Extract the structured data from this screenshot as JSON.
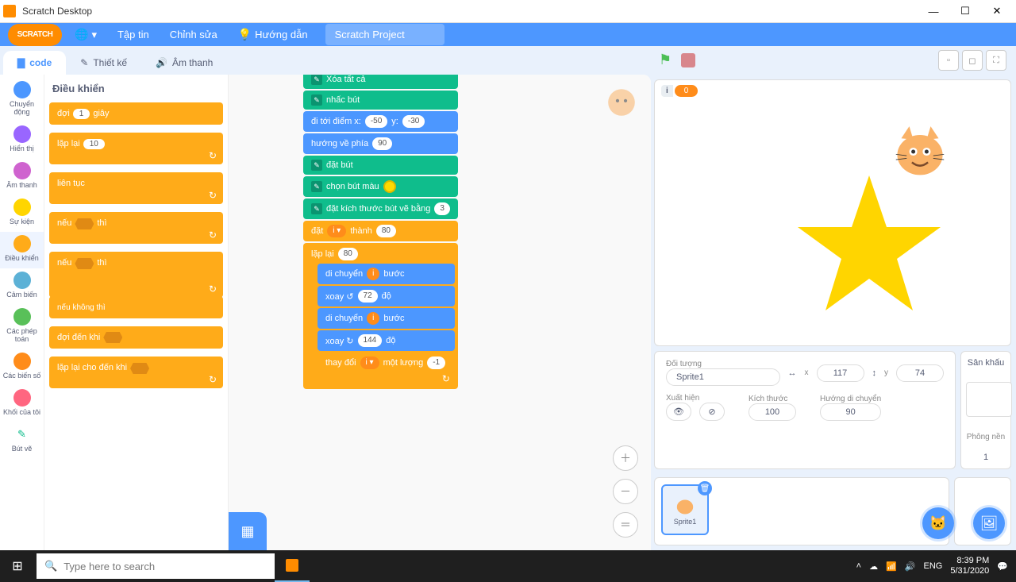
{
  "window": {
    "title": "Scratch Desktop"
  },
  "menu": {
    "file": "Tập tin",
    "edit": "Chỉnh sửa",
    "tutorials": "Hướng dẫn",
    "project_name": "Scratch Project"
  },
  "tabs": {
    "code": "code",
    "costumes": "Thiết kế",
    "sounds": "Âm thanh"
  },
  "categories": [
    {
      "name": "Chuyển động",
      "color": "#4c97ff"
    },
    {
      "name": "Hiển thị",
      "color": "#9966ff"
    },
    {
      "name": "Âm thanh",
      "color": "#cf63cf"
    },
    {
      "name": "Sự kiện",
      "color": "#ffd500"
    },
    {
      "name": "Điều khiển",
      "color": "#ffab19",
      "selected": true
    },
    {
      "name": "Cảm biến",
      "color": "#5cb1d6"
    },
    {
      "name": "Các phép toán",
      "color": "#59c059"
    },
    {
      "name": "Các biến số",
      "color": "#ff8c1a"
    },
    {
      "name": "Khối của tôi",
      "color": "#ff6680"
    },
    {
      "name": "Bút vẽ",
      "color": "#0fbd8c",
      "icon": "pen"
    }
  ],
  "palette": {
    "title": "Điều khiển",
    "blocks": {
      "wait": {
        "label": "đợi",
        "val": "1",
        "suffix": "giây"
      },
      "repeat": {
        "label": "lặp lại",
        "val": "10"
      },
      "forever": "liên tục",
      "if": {
        "pre": "nếu",
        "post": "thì"
      },
      "ifelse": {
        "pre": "nếu",
        "post": "thì"
      },
      "else_label": "nếu không thì",
      "wait_until": "đợi đến khi",
      "repeat_until": "lặp lại cho đến khi"
    }
  },
  "script": {
    "erase_all": "Xóa tất cả",
    "pen_up": "nhấc bút",
    "goto": {
      "label": "đi tới điểm x:",
      "x": "-50",
      "ymid": "y:",
      "y": "-30"
    },
    "point_dir": {
      "label": "hướng về phía",
      "val": "90"
    },
    "pen_down": "đặt bút",
    "set_color": "chọn bút màu",
    "set_size": {
      "label": "đặt kích thước bút vẽ bằng",
      "val": "3"
    },
    "set_var": {
      "pre": "đặt",
      "var": "i ▾",
      "mid": "thành",
      "val": "80"
    },
    "repeat": {
      "label": "lặp lại",
      "val": "80"
    },
    "move1": {
      "pre": "di chuyển",
      "var": "i",
      "post": "bước"
    },
    "turn_ccw": {
      "pre": "xoay ↺",
      "val": "72",
      "post": "độ"
    },
    "move2": {
      "pre": "di chuyển",
      "var": "i",
      "post": "bước"
    },
    "turn_cw": {
      "pre": "xoay ↻",
      "val": "144",
      "post": "độ"
    },
    "change_var": {
      "pre": "thay đổi",
      "var": "i ▾",
      "mid": "một lượng",
      "val": "-1"
    }
  },
  "stage_monitor": {
    "name": "i",
    "value": "0"
  },
  "sprite_info": {
    "header": "Đối tượng",
    "name": "Sprite1",
    "x_label": "x",
    "x": "117",
    "y_label": "y",
    "y": "74",
    "show_label": "Xuất hiện",
    "size_label": "Kích thước",
    "size": "100",
    "dir_label": "Hướng di chuyển",
    "dir": "90"
  },
  "stage_panel": {
    "title": "Sân khấu",
    "backdrops_label": "Phông nền",
    "backdrops": "1"
  },
  "sprite_card": {
    "name": "Sprite1"
  },
  "taskbar": {
    "search_placeholder": "Type here to search",
    "lang": "ENG",
    "time": "8:39 PM",
    "date": "5/31/2020"
  }
}
